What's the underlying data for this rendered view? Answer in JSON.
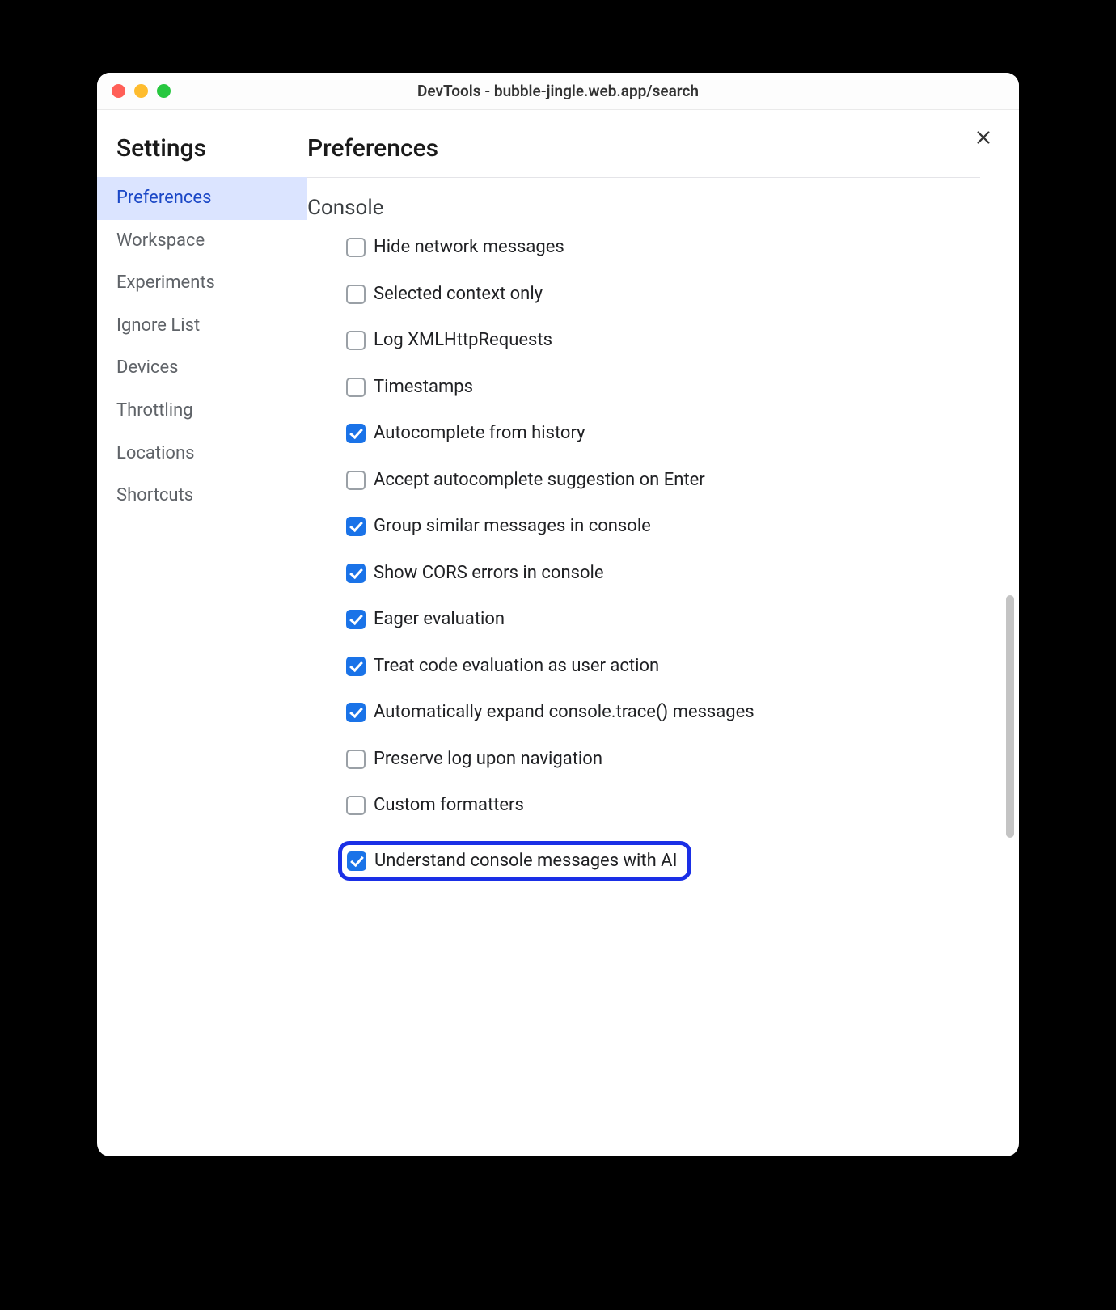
{
  "window": {
    "title": "DevTools - bubble-jingle.web.app/search"
  },
  "sidebar": {
    "title": "Settings",
    "items": [
      {
        "label": "Preferences",
        "active": true
      },
      {
        "label": "Workspace",
        "active": false
      },
      {
        "label": "Experiments",
        "active": false
      },
      {
        "label": "Ignore List",
        "active": false
      },
      {
        "label": "Devices",
        "active": false
      },
      {
        "label": "Throttling",
        "active": false
      },
      {
        "label": "Locations",
        "active": false
      },
      {
        "label": "Shortcuts",
        "active": false
      }
    ]
  },
  "main": {
    "title": "Preferences",
    "section": "Console",
    "options": [
      {
        "label": "Hide network messages",
        "checked": false,
        "highlight": false
      },
      {
        "label": "Selected context only",
        "checked": false,
        "highlight": false
      },
      {
        "label": "Log XMLHttpRequests",
        "checked": false,
        "highlight": false
      },
      {
        "label": "Timestamps",
        "checked": false,
        "highlight": false
      },
      {
        "label": "Autocomplete from history",
        "checked": true,
        "highlight": false
      },
      {
        "label": "Accept autocomplete suggestion on Enter",
        "checked": false,
        "highlight": false
      },
      {
        "label": "Group similar messages in console",
        "checked": true,
        "highlight": false
      },
      {
        "label": "Show CORS errors in console",
        "checked": true,
        "highlight": false
      },
      {
        "label": "Eager evaluation",
        "checked": true,
        "highlight": false
      },
      {
        "label": "Treat code evaluation as user action",
        "checked": true,
        "highlight": false
      },
      {
        "label": "Automatically expand console.trace() messages",
        "checked": true,
        "highlight": false
      },
      {
        "label": "Preserve log upon navigation",
        "checked": false,
        "highlight": false
      },
      {
        "label": "Custom formatters",
        "checked": false,
        "highlight": false
      },
      {
        "label": "Understand console messages with AI",
        "checked": true,
        "highlight": true
      }
    ]
  }
}
